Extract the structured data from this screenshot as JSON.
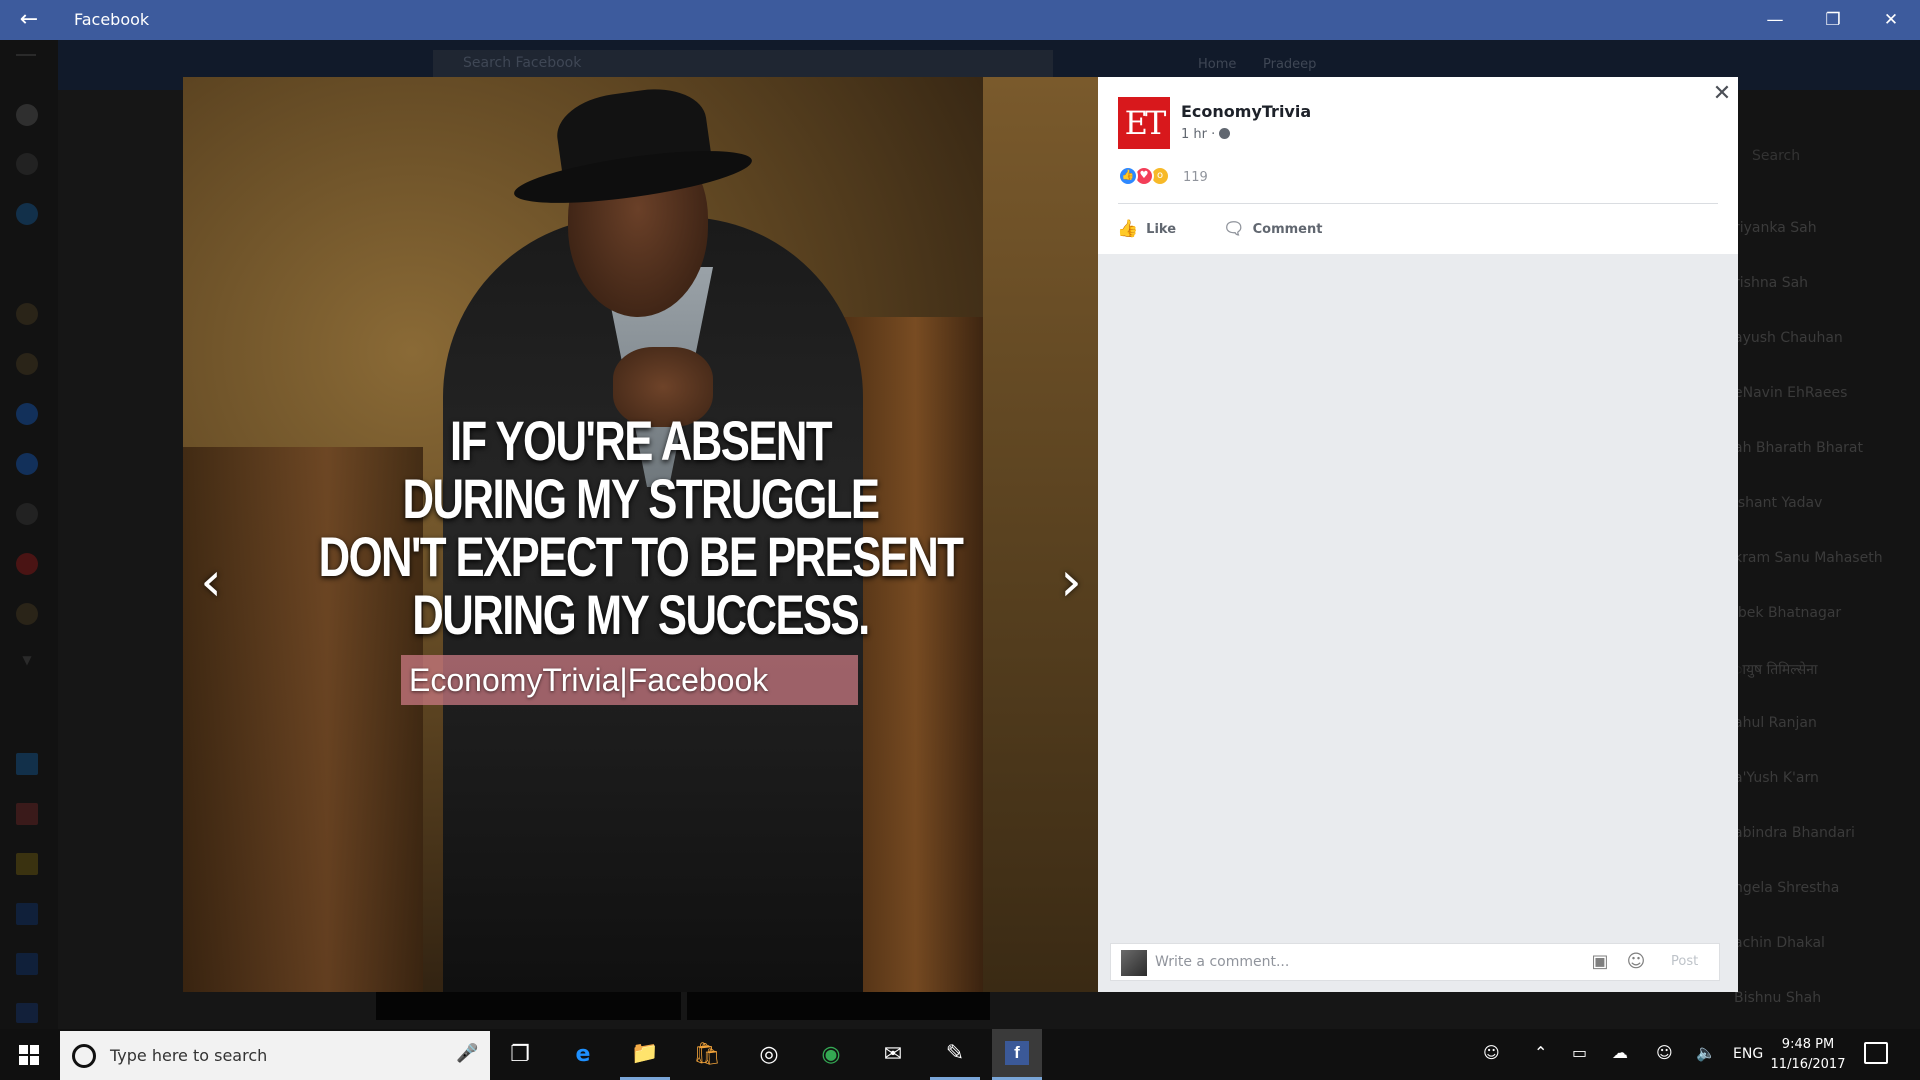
{
  "window": {
    "title": "Facebook",
    "back_icon": "arrow-left-icon",
    "minimize_icon": "minimize-icon",
    "restore_icon": "restore-icon",
    "close_icon": "close-icon",
    "accent": "#3d5b9d"
  },
  "background_app": {
    "search_placeholder": "Search Facebook",
    "nav": [
      "Home",
      "Pradeep"
    ],
    "sidebar_search": "Search",
    "friends": [
      "riyanka Sah",
      "rishna Sah",
      "ayush Chauhan",
      "eNavin EhRaees",
      "ah Bharath Bharat",
      "ishant Yadav",
      "kram Sanu Mahaseth",
      "ibek Bhatnagar",
      "ायुष तिमिल्सेना",
      "ahul Ranjan",
      "a'Yush K'arn",
      "abindra Bhandari",
      "ngela Shrestha",
      "achin Dhakal",
      "Bishnu Shah"
    ]
  },
  "photo": {
    "quote_lines": [
      "IF YOU'RE ABSENT",
      "DURING MY STRUGGLE",
      "DON'T EXPECT TO BE PRESENT",
      "DURING MY SUCCESS."
    ],
    "watermark": "EconomyTrivia|Facebook",
    "prev_icon": "chevron-left-icon",
    "next_icon": "chevron-right-icon"
  },
  "post": {
    "page_logo": "ET",
    "page_name": "EconomyTrivia",
    "time": "1 hr ·",
    "privacy_icon": "globe-icon",
    "reactions": [
      "like-reaction-icon",
      "love-reaction-icon",
      "wow-reaction-icon"
    ],
    "reaction_count": "119",
    "like_label": "Like",
    "comment_label": "Comment",
    "close_icon": "close-icon"
  },
  "comment": {
    "placeholder": "Write a comment...",
    "photo_icon": "photo-icon",
    "emoji_icon": "emoji-icon",
    "post_label": "Post"
  },
  "taskbar": {
    "search_placeholder": "Type here to search",
    "apps": [
      "task-view-icon",
      "edge-icon",
      "file-explorer-icon",
      "store-icon",
      "groove-icon",
      "chrome-icon",
      "mail-icon",
      "pen-icon",
      "facebook-icon"
    ],
    "language": "ENG",
    "time": "9:48 PM",
    "date": "11/16/2017"
  }
}
